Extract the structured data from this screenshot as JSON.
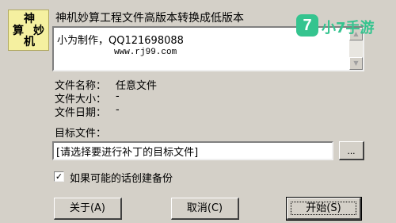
{
  "logo": {
    "chars": [
      "神",
      "算",
      "妙",
      "机"
    ]
  },
  "title": "神机妙算工程文件高版本转换成低版本",
  "info": {
    "line1": "小为制作，QQ121698088",
    "line2": "www.rj99.com"
  },
  "scroll_icons": {
    "up": "▲",
    "down": "▼"
  },
  "file_props": [
    {
      "label": "文件名称：",
      "value": "任意文件"
    },
    {
      "label": "文件大小：",
      "value": "-"
    },
    {
      "label": "文件日期：",
      "value": "-"
    }
  ],
  "target": {
    "label": "目标文件：",
    "value": "[请选择要进行补丁的目标文件]",
    "browse_label": "..."
  },
  "backup": {
    "checked_mark": "✓",
    "label": "如果可能的话创建备份"
  },
  "buttons": {
    "about": "关于(A)",
    "cancel": "取消(C)",
    "start": "开始(S)"
  },
  "watermark": {
    "badge": "7",
    "text": "小7手游",
    "color": "#35c48f"
  }
}
